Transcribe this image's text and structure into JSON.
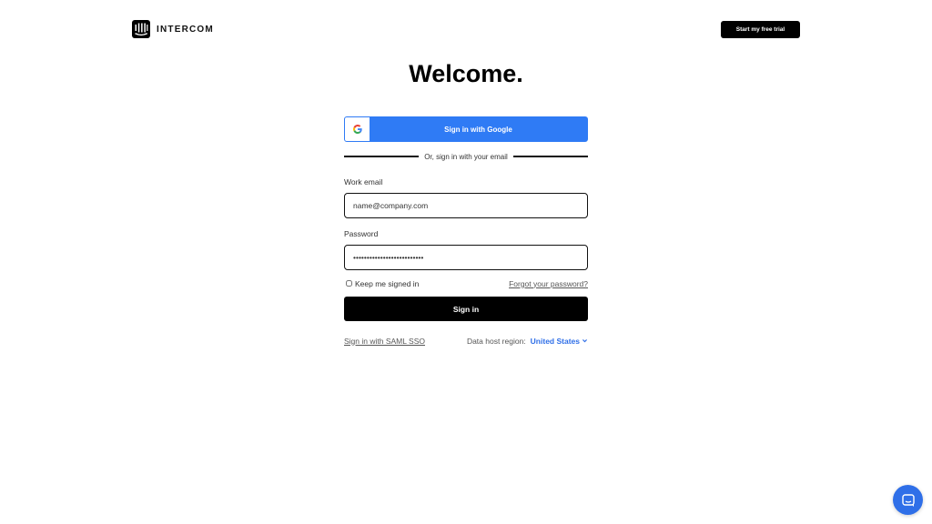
{
  "header": {
    "logo_text": "INTERCOM",
    "trial_button": "Start my free trial"
  },
  "title": "Welcome.",
  "google": {
    "icon": "google-g-icon",
    "label": "Sign in with Google"
  },
  "divider_text": "Or, sign in with your email",
  "email": {
    "label": "Work email",
    "value": "name@company.com"
  },
  "password": {
    "label": "Password",
    "value": "••••••••••••••••••••••••••"
  },
  "keep_signed_in": {
    "label": "Keep me signed in",
    "checked": false
  },
  "forgot_password": "Forgot your password?",
  "sign_in_button": "Sign in",
  "saml_link": "Sign in with SAML SSO",
  "region": {
    "label": "Data host region:",
    "value": "United States"
  },
  "colors": {
    "google_blue": "#2f7bf5",
    "link_blue": "#2f6fe8",
    "primary_black": "#000000"
  },
  "icons": {
    "chat": "chat-bubble-icon",
    "chevron": "chevron-down-icon",
    "logo": "intercom-logo-icon"
  }
}
